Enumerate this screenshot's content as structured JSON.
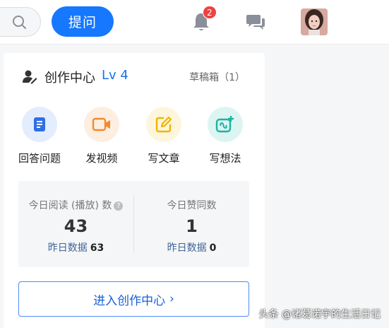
{
  "header": {
    "ask_label": "提问",
    "notification_count": "2"
  },
  "creator": {
    "title": "创作中心",
    "level": "Lv 4",
    "drafts": "草稿箱（1）",
    "actions": [
      {
        "label": "回答问题",
        "icon": "answer-doc-icon",
        "color": "#2f6fe4",
        "bg": "#e3edfd"
      },
      {
        "label": "发视频",
        "icon": "video-icon",
        "color": "#f5892a",
        "bg": "#fdeee2"
      },
      {
        "label": "写文章",
        "icon": "edit-icon",
        "color": "#f0b400",
        "bg": "#fdf6dd"
      },
      {
        "label": "写想法",
        "icon": "idea-link-icon",
        "color": "#1bb3a3",
        "bg": "#ddf5f2"
      }
    ],
    "stats": [
      {
        "title": "今日阅读 (播放) 数",
        "value": "43",
        "yesterday_label": "昨日数据",
        "yesterday_value": "63"
      },
      {
        "title": "今日赞同数",
        "value": "1",
        "yesterday_label": "昨日数据",
        "yesterday_value": "0"
      }
    ],
    "help_mark": "?",
    "enter_label": "进入创作中心",
    "enter_chevron": "›"
  },
  "watermark": "头条 @诸葛诺宇的生活日记"
}
